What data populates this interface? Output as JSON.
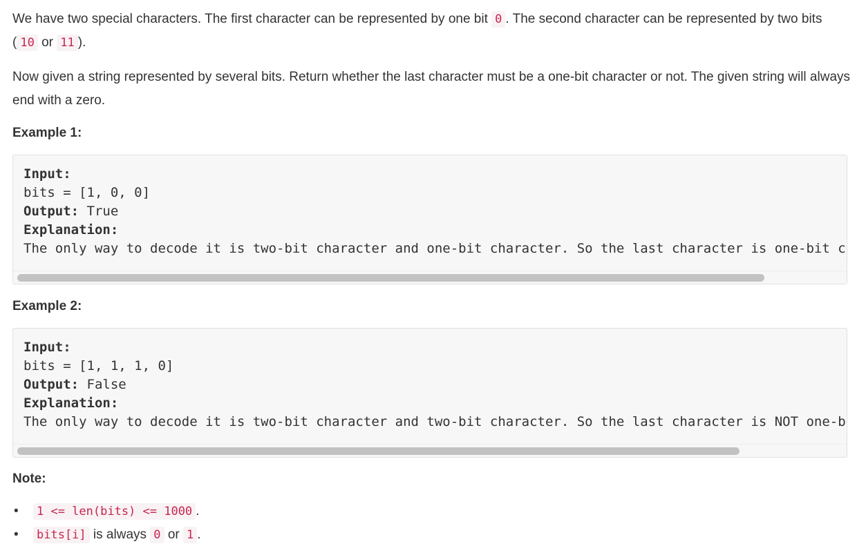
{
  "intro": {
    "p1_a": "We have two special characters. The first character can be represented by one bit ",
    "p1_code1": "0",
    "p1_b": ". The second character can be represented by two bits (",
    "p1_code2": "10",
    "p1_c": " or ",
    "p1_code3": "11",
    "p1_d": ").",
    "p2": "Now given a string represented by several bits. Return whether the last character must be a one-bit character or not. The given string will always end with a zero."
  },
  "examples": [
    {
      "heading": "Example 1:",
      "input_label": "Input:",
      "input_value": "bits = [1, 0, 0]",
      "output_label": "Output:",
      "output_value": " True",
      "explanation_label": "Explanation:",
      "explanation_text": "The only way to decode it is two-bit character and one-bit character. So the last character is one-bit c",
      "scroll_fraction": 0.905
    },
    {
      "heading": "Example 2:",
      "input_label": "Input:",
      "input_value": "bits = [1, 1, 1, 0]",
      "output_label": "Output:",
      "output_value": " False",
      "explanation_label": "Explanation:",
      "explanation_text": "The only way to decode it is two-bit character and two-bit character. So the last character is NOT one-b",
      "scroll_fraction": 0.875
    }
  ],
  "note": {
    "heading": "Note:",
    "bullet": "•",
    "item1_code": "1 <= len(bits) <= 1000",
    "item1_tail": ".",
    "item2_code": "bits[i]",
    "item2_mid": " is always ",
    "item2_code2": "0",
    "item2_or": " or ",
    "item2_code3": "1",
    "item2_tail": "."
  }
}
